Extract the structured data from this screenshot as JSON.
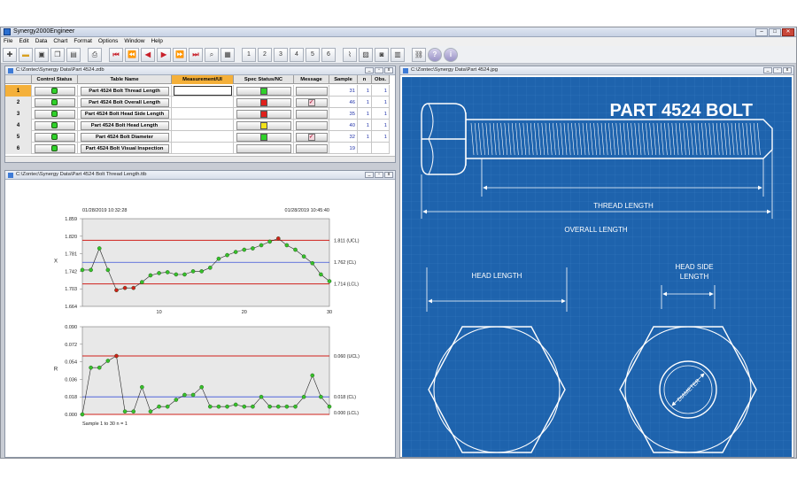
{
  "app": {
    "title": "Synergy2000Engineer",
    "menu": [
      "File",
      "Edit",
      "Data",
      "Chart",
      "Format",
      "Options",
      "Window",
      "Help"
    ],
    "toolbar_numbers": [
      "1",
      "2",
      "3",
      "4",
      "5",
      "6"
    ]
  },
  "table_window": {
    "title": "C:\\Zontec\\Synergy Data\\Part 4524.zdb",
    "columns": [
      "",
      "Control Status",
      "Table Name",
      "Measurement/UI",
      "Spec Status/NC",
      "Message",
      "Sample",
      "n",
      "Obs."
    ],
    "rows": [
      {
        "num": "1",
        "name": "Part 4524 Bolt Thread Length",
        "spec": "#2fd12a",
        "message": false,
        "sample": "31",
        "n": "1",
        "obs": "1"
      },
      {
        "num": "2",
        "name": "Part 4524 Bolt Overall Length",
        "spec": "#e0201c",
        "message": true,
        "sample": "46",
        "n": "1",
        "obs": "1"
      },
      {
        "num": "3",
        "name": "Part 4524 Bolt Head Side Length",
        "spec": "#e0201c",
        "message": false,
        "sample": "35",
        "n": "1",
        "obs": "1"
      },
      {
        "num": "4",
        "name": "Part 4524 Bolt Head Length",
        "spec": "#f2e21a",
        "message": false,
        "sample": "40",
        "n": "1",
        "obs": "1"
      },
      {
        "num": "5",
        "name": "Part 4524 Bolt Diameter",
        "spec": "#2fd12a",
        "message": true,
        "sample": "32",
        "n": "1",
        "obs": "1"
      },
      {
        "num": "6",
        "name": "Part 4524 Bolt Visual Inspection",
        "spec": "",
        "message": false,
        "sample": "19",
        "n": "",
        "obs": ""
      }
    ]
  },
  "chart_window": {
    "title": "C:\\Zontec\\Synergy Data\\Part 4524 Bolt Thread Length.ttb"
  },
  "chart_data": [
    {
      "type": "line",
      "name": "X chart",
      "ylabel": "X",
      "date_start": "01/28/2019  10:32:28",
      "date_end": "01/28/2019  10:45:40",
      "y_ticks": [
        "1.859",
        "1.820",
        "1.781",
        "1.742",
        "1.703",
        "1.664"
      ],
      "ylim": [
        1.664,
        1.859
      ],
      "xlim": [
        1,
        30
      ],
      "x_ticks": [
        "10",
        "20",
        "30"
      ],
      "ucl": 1.811,
      "cl": 1.762,
      "lcl": 1.714,
      "ucl_label": "1.811 (UCL)",
      "cl_label": "1.762 (CL)",
      "lcl_label": "1.714 (LCL)",
      "values": [
        1.745,
        1.745,
        1.793,
        1.745,
        1.7,
        1.705,
        1.705,
        1.718,
        1.733,
        1.738,
        1.74,
        1.735,
        1.735,
        1.742,
        1.742,
        1.75,
        1.77,
        1.778,
        1.785,
        1.79,
        1.793,
        1.8,
        1.808,
        1.815,
        1.8,
        1.79,
        1.775,
        1.76,
        1.735,
        1.72
      ]
    },
    {
      "type": "line",
      "name": "R chart",
      "ylabel": "R",
      "y_ticks": [
        "0.090",
        "0.072",
        "0.054",
        "0.036",
        "0.018",
        "0.000"
      ],
      "ylim": [
        0,
        0.09
      ],
      "ucl": 0.06,
      "cl": 0.018,
      "lcl": 0.0,
      "ucl_label": "0.060 (UCL)",
      "cl_label": "0.018 (CL)",
      "lcl_label": "0.000 (LCL)",
      "values": [
        0.0,
        0.048,
        0.048,
        0.055,
        0.06,
        0.003,
        0.003,
        0.028,
        0.003,
        0.008,
        0.008,
        0.015,
        0.02,
        0.02,
        0.028,
        0.008,
        0.008,
        0.008,
        0.01,
        0.008,
        0.008,
        0.018,
        0.008,
        0.008,
        0.008,
        0.008,
        0.018,
        0.04,
        0.018,
        0.008
      ],
      "footer": "Sample  1  to  30  n = 1"
    }
  ],
  "image_window": {
    "title": "C:\\Zontec\\Synergy Data\\Part 4524.jpg",
    "heading": "PART 4524 BOLT",
    "thread_length": "THREAD LENGTH",
    "overall_length": "OVERALL LENGTH",
    "head_length": "HEAD LENGTH",
    "head_side_1": "HEAD SIDE",
    "head_side_2": "LENGTH",
    "diameter": "DIAMETER",
    "blueprint_color": "#1e63ad"
  }
}
